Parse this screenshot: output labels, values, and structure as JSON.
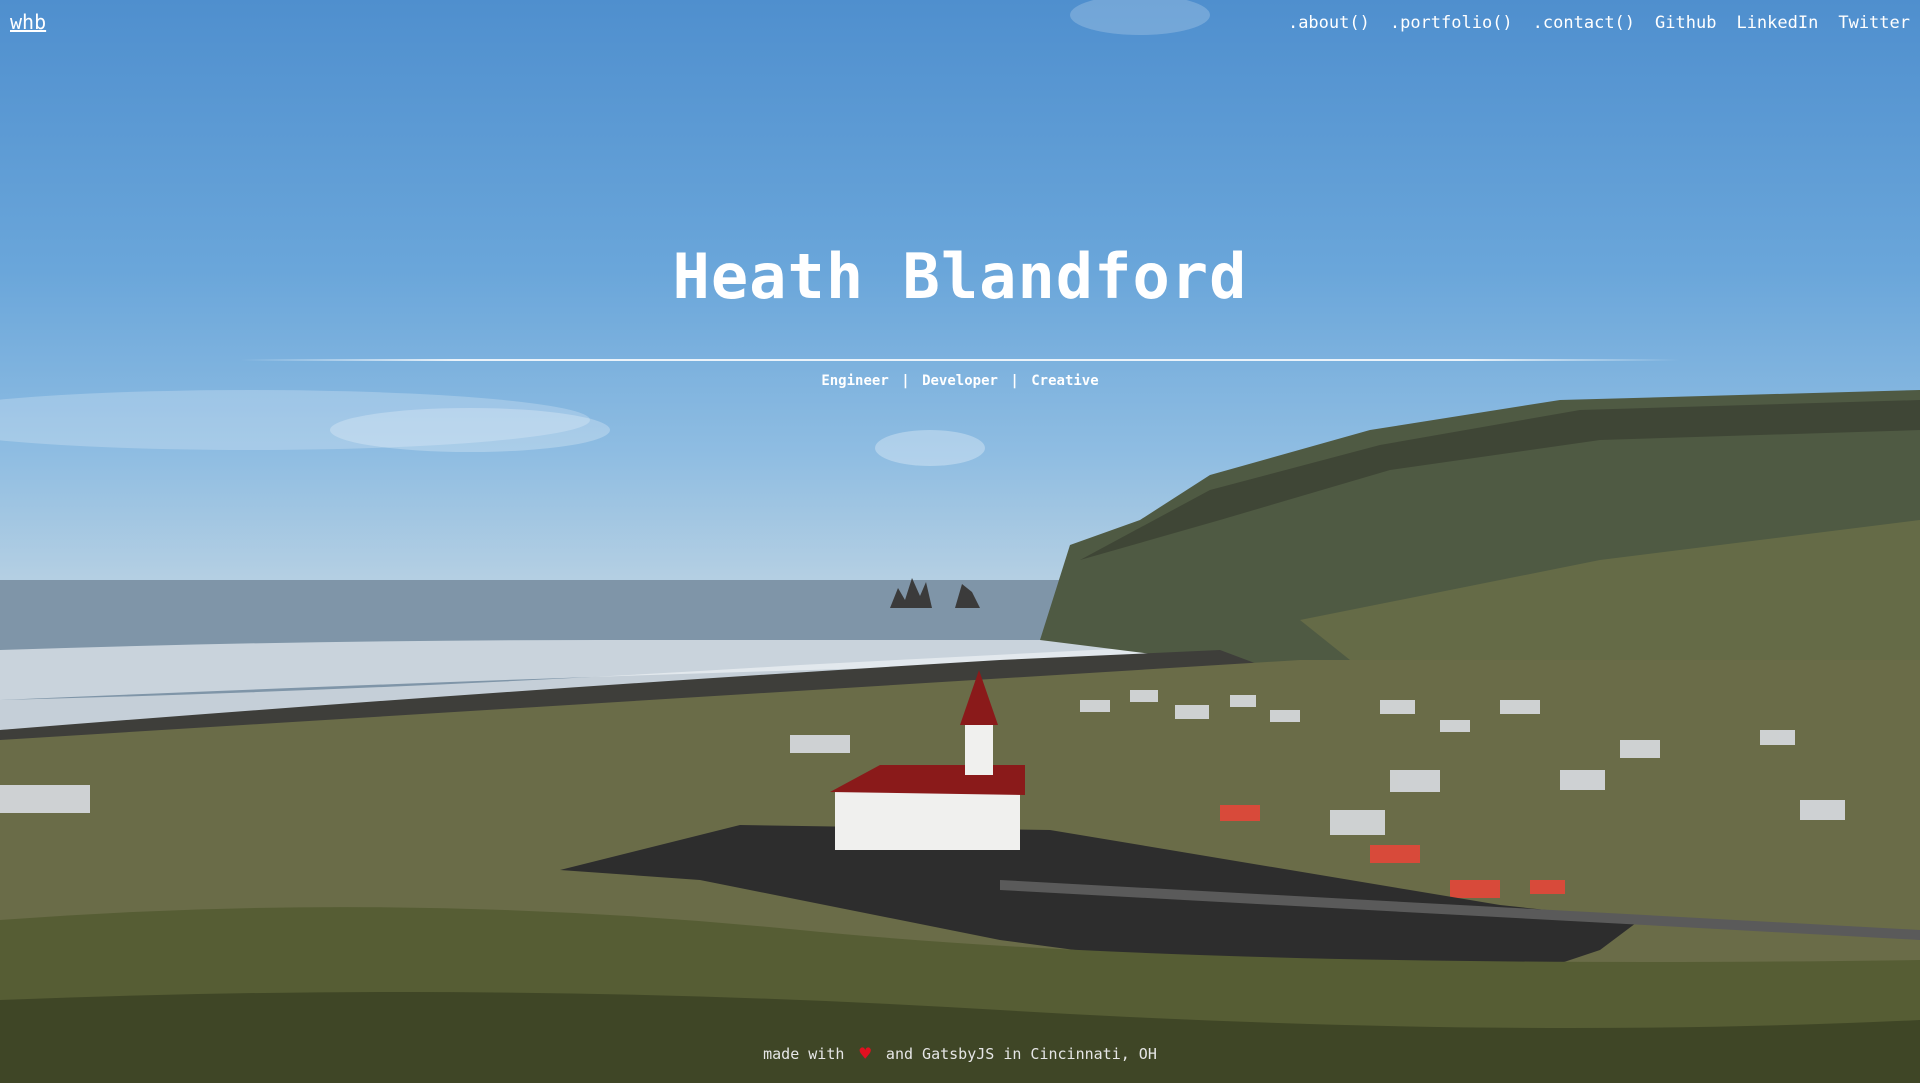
{
  "nav": {
    "brand": "whb",
    "links": [
      ".about()",
      ".portfolio()",
      ".contact()",
      "Github",
      "LinkedIn",
      "Twitter"
    ]
  },
  "hero": {
    "title": "Heath Blandford",
    "roles": [
      "Engineer",
      "Developer",
      "Creative"
    ],
    "separator": "|"
  },
  "footer": {
    "before": "made with",
    "heart": "♥",
    "after": "and GatsbyJS in Cincinnati, OH"
  },
  "colors": {
    "text": "#ffffff",
    "heart": "#e01020",
    "sky": "#4f8fce",
    "church_roof": "#8a1a1a"
  }
}
